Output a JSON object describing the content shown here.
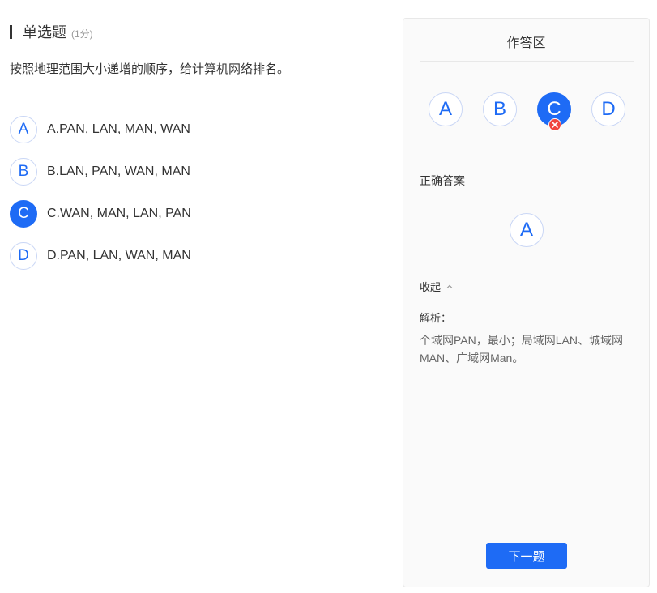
{
  "question": {
    "type": "单选题",
    "score": "(1分)",
    "text": "按照地理范围大小递增的顺序，给计算机网络排名。",
    "options": [
      {
        "letter": "A",
        "text": "A.PAN, LAN, MAN, WAN",
        "selected": false
      },
      {
        "letter": "B",
        "text": "B.LAN, PAN, WAN, MAN",
        "selected": false
      },
      {
        "letter": "C",
        "text": "C.WAN, MAN, LAN, PAN",
        "selected": true
      },
      {
        "letter": "D",
        "text": "D.PAN, LAN, WAN, MAN",
        "selected": false
      }
    ]
  },
  "panel": {
    "title": "作答区",
    "answers": [
      "A",
      "B",
      "C",
      "D"
    ],
    "selected_answer": "C",
    "selected_status": "wrong",
    "correct_label": "正确答案",
    "correct_answer": "A",
    "collapse_label": "收起",
    "analysis_label": "解析：",
    "analysis_text": "个域网PAN，最小；局域网LAN、城域网MAN、广域网Man。",
    "next_button": "下一题"
  },
  "colors": {
    "accent": "#1e6bf5",
    "wrong": "#f0463f",
    "text": "#333333",
    "muted": "#999999",
    "panel_bg": "#fafafa"
  }
}
